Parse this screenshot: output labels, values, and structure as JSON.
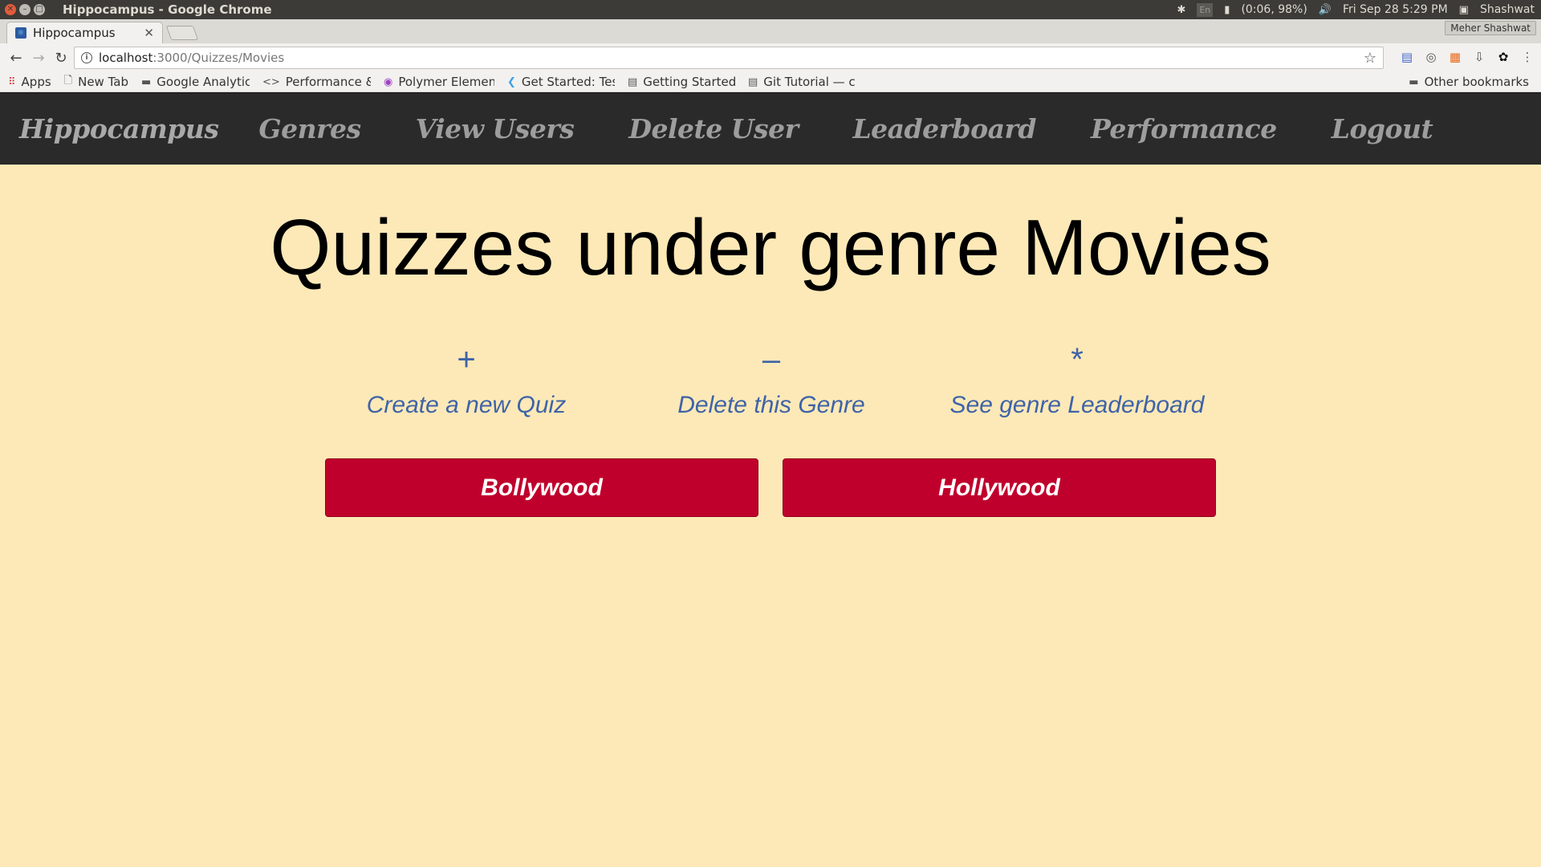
{
  "os_bar": {
    "title": "Hippocampus - Google Chrome",
    "lang": "En",
    "battery": "(0:06, 98%)",
    "datetime": "Fri Sep 28  5:29 PM",
    "user": "Shashwat"
  },
  "browser": {
    "tab_title": "Hippocampus",
    "profile_name": "Meher Shashwat",
    "url_host": "localhost",
    "url_path": ":3000/Quizzes/Movies"
  },
  "bookmarks": {
    "items": [
      "Apps",
      "New Tab",
      "Google Analytic",
      "Performance & ",
      "Polymer Elemen",
      "Get Started: Tes",
      "Getting Started",
      "Git Tutorial — c"
    ],
    "other": "Other bookmarks"
  },
  "nav": {
    "brand": "Hippocampus",
    "links": [
      "Genres",
      "View Users",
      "Delete User",
      "Leaderboard",
      "Performance",
      "Logout"
    ]
  },
  "main": {
    "title": "Quizzes under genre Movies",
    "actions": [
      {
        "glyph": "+",
        "label": "Create a new Quiz"
      },
      {
        "glyph": "–",
        "label": "Delete this Genre"
      },
      {
        "glyph": "*",
        "label": "See genre Leaderboard"
      }
    ],
    "quizzes": [
      "Bollywood",
      "Hollywood"
    ]
  },
  "colors": {
    "page_bg": "#fde9b7",
    "nav_bg": "#2a2a2a",
    "action_blue": "#3e63a8",
    "quiz_red": "#c0002c"
  }
}
